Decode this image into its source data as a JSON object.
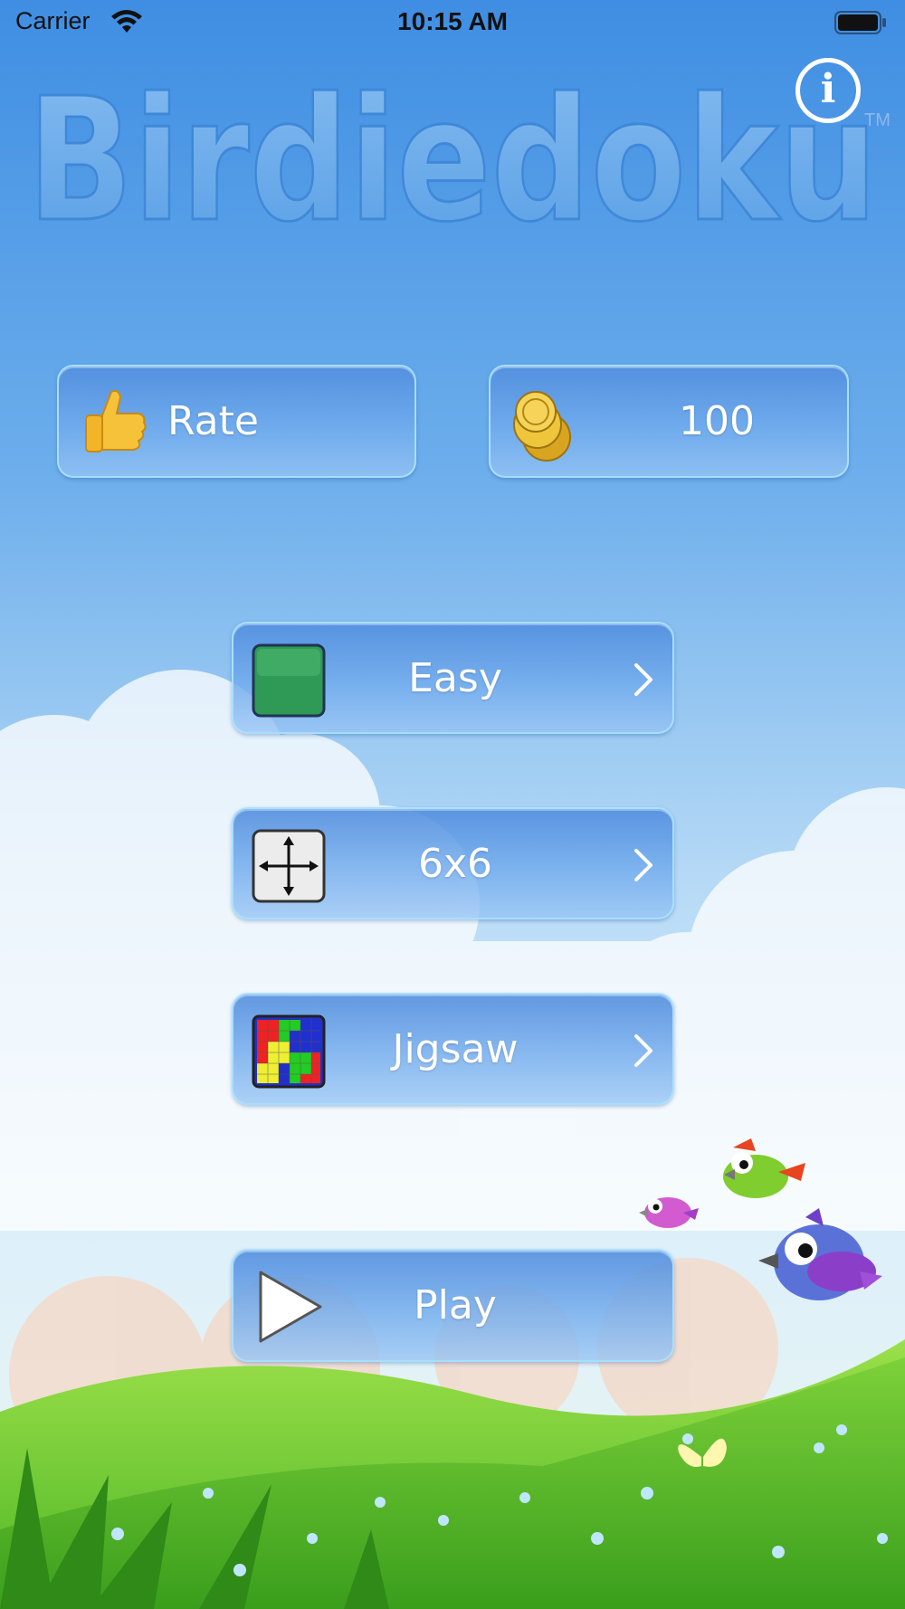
{
  "status_bar": {
    "carrier": "Carrier",
    "time": "10:15 AM"
  },
  "app": {
    "title": "Birdiedoku",
    "trademark": "TM",
    "info_label": "i"
  },
  "rate_button": {
    "label": "Rate",
    "icon": "thumbs-up-icon"
  },
  "coins_button": {
    "value": "100",
    "icon": "gold-coins-icon"
  },
  "menu": {
    "difficulty": {
      "label": "Easy",
      "icon": "green-square-icon"
    },
    "grid_size": {
      "label": "6x6",
      "icon": "move-arrows-icon"
    },
    "puzzle_type": {
      "label": "Jigsaw",
      "icon": "jigsaw-grid-icon"
    },
    "play": {
      "label": "Play",
      "icon": "play-triangle-icon"
    }
  },
  "colors": {
    "sky_top": "#3f8ee3",
    "sky_bottom": "#dceffb",
    "button_fill": "#6fa8ea",
    "grass": "#5cc42e",
    "easy_green": "#2e9a55"
  }
}
